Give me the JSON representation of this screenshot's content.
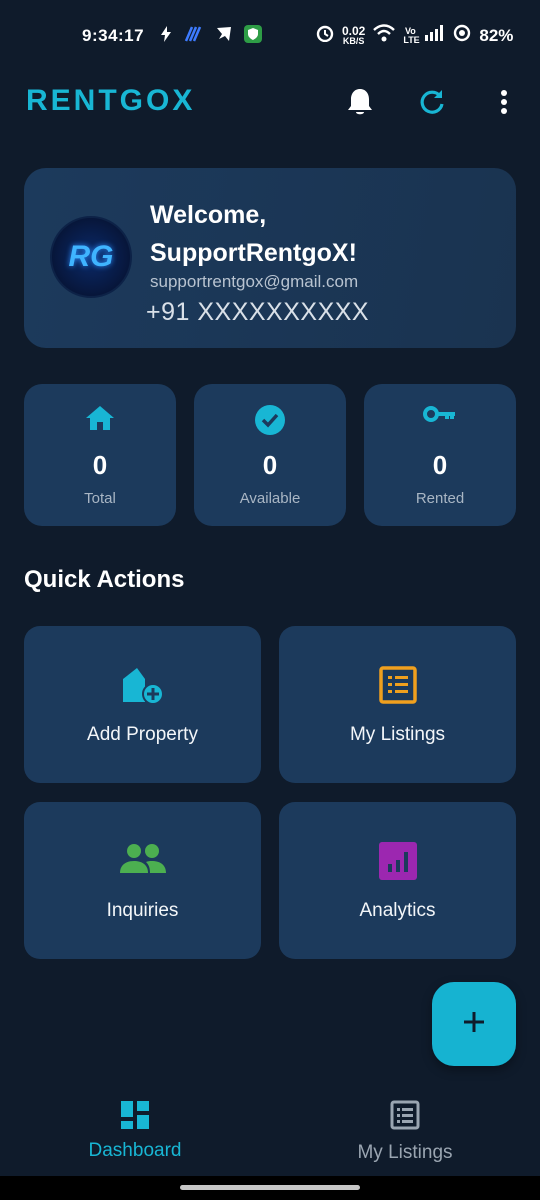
{
  "status_bar": {
    "time": "9:34:17",
    "net_speed_top": "0.02",
    "net_speed_bottom": "KB/S",
    "volte": "Vo LTE",
    "battery": "82%"
  },
  "app_bar": {
    "title": "RENTGOX",
    "accent_color": "#18b6d4"
  },
  "welcome": {
    "greeting_line1": "Welcome,",
    "greeting_line2": "SupportRentgoX!",
    "email": "supportrentgox@gmail.com",
    "phone": "+91 XXXXXXXXXX",
    "avatar_text": "RG"
  },
  "stats": [
    {
      "icon": "home-icon",
      "value": "0",
      "label": "Total"
    },
    {
      "icon": "check-circle-icon",
      "value": "0",
      "label": "Available"
    },
    {
      "icon": "key-icon",
      "value": "0",
      "label": "Rented"
    }
  ],
  "quick_actions": {
    "title": "Quick Actions",
    "items": [
      {
        "icon": "add-home-icon",
        "label": "Add Property",
        "color": "#18b6d4"
      },
      {
        "icon": "list-icon",
        "label": "My Listings",
        "color": "#f0a01e"
      },
      {
        "icon": "people-icon",
        "label": "Inquiries",
        "color": "#4caf50"
      },
      {
        "icon": "analytics-icon",
        "label": "Analytics",
        "color": "#9c27b0"
      }
    ]
  },
  "fab": {
    "icon": "plus-icon"
  },
  "bottom_nav": {
    "items": [
      {
        "icon": "dashboard-icon",
        "label": "Dashboard",
        "active": true
      },
      {
        "icon": "list-icon",
        "label": "My Listings",
        "active": false
      }
    ],
    "active_color": "#18b6d4",
    "inactive_color": "#9aa5b1"
  }
}
